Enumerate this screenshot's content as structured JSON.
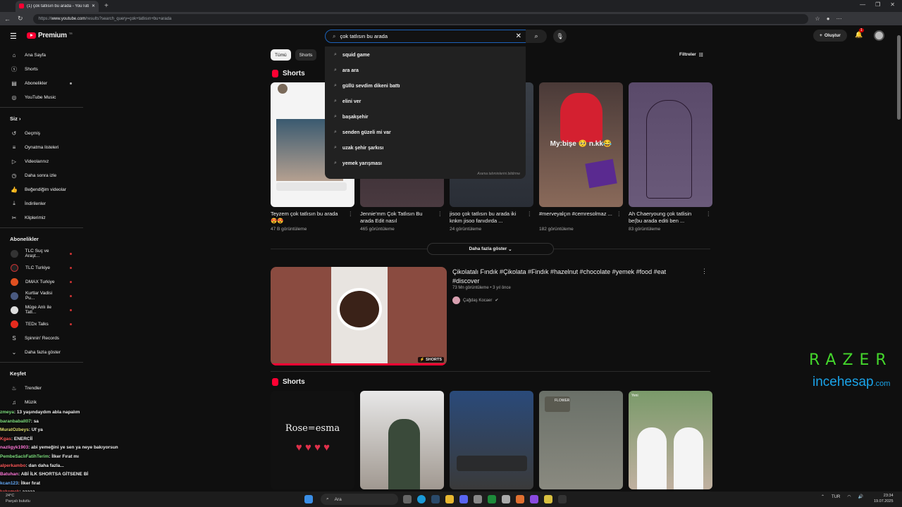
{
  "browser": {
    "tab_title": "(1) çok tatlısın bu arada - YouTube",
    "url_prefix": "https://",
    "url_host": "www.youtube.com",
    "url_path": "/results?search_query=çok+tatlısın+bu+arada"
  },
  "masthead": {
    "logo_text": "Premium",
    "logo_sup": "TR",
    "search_value": "çok tatlısın bu arada",
    "create_label": "Oluştur",
    "notif_count": "1"
  },
  "suggestions": {
    "items": [
      "squid game",
      "ara ara",
      "güllü sevdim dikeni battı",
      "elini ver",
      "başakşehir",
      "senden güzeli mi var",
      "uzak şehir şarkısı",
      "yemek yarışması"
    ],
    "footer": "Arama tahminlerini bildirme"
  },
  "sidebar": {
    "main": [
      "Ana Sayfa",
      "Shorts",
      "Abonelikler",
      "YouTube Music"
    ],
    "you_header": "Siz",
    "you": [
      "Geçmiş",
      "Oynatma listeleri",
      "Videolarınız",
      "Daha sonra izle",
      "Beğendiğim videolar",
      "İndirilenler",
      "Kliplerimiz"
    ],
    "subs_header": "Abonelikler",
    "subs": [
      "TLC Suç ve Araşt...",
      "TLC Turkiye",
      "DMAX Turkiye",
      "Kurtlar Vadisi Pu...",
      "Müge Anlı ile Tatl...",
      "TEDx Talks",
      "Spinnin' Records",
      "Daha fazla göster"
    ],
    "explore_header": "Keşfet",
    "explore": [
      "Trendler",
      "Müzik"
    ]
  },
  "chips": [
    "Tümü",
    "Shorts"
  ],
  "filters_label": "Filtreler",
  "shorts_title": "Shorts",
  "shorts1": [
    {
      "title": "Teyzem çok tatlısın bu arada 😍😍",
      "views": "47 B görüntüleme"
    },
    {
      "title": "Jennie'mm Çok Tatlısın Bu arada Edit nasıl",
      "views": "465 görüntüleme"
    },
    {
      "title": "jisoo çok tatlısın bu arada iki knkm jisoo fanıdırda ...",
      "views": "24 görüntüleme"
    },
    {
      "title": "#merveyalçın #cemresolmaz ...",
      "views": "182 görüntüleme"
    },
    {
      "title": "Ah Chaeryoung çok tatlisin be(bu arada editi ben ...",
      "views": "83 görüntüleme"
    }
  ],
  "more_label": "Daha fazla göster",
  "video": {
    "title": "Çikolatalı Fındık #Çikolata #Findık #hazelnut #chocolate #yemek #food #eat #discover",
    "meta": "73 Mn görüntüleme • 3 yıl önce",
    "channel": "Çağdaş Kocaer",
    "badge": "SHORTS"
  },
  "thumb_text": {
    "merve": "My:bişe 🥺 n.kk😂",
    "rose": "Rose=esma",
    "flower": "FLOWER",
    "yeni": "Yeni"
  },
  "overlay": {
    "razer": "RAZER",
    "ince": "incehesap",
    "ince_suffix": ".com"
  },
  "chat": [
    {
      "u": "zmeya",
      "m": ": 13 yaşındaydım abla napalım",
      "c": ""
    },
    {
      "u": "baranbaball07",
      "m": ": sa",
      "c": ""
    },
    {
      "u": "MuratOzbeys",
      "m": ": Uf ya",
      "c": "y"
    },
    {
      "u": "Kgas",
      "m": ": ENERCİİ",
      "c": "r"
    },
    {
      "u": "nazligyk1903",
      "m": ": abi yemeğini ye sen ya neye bakıyorsun",
      "c": "p"
    },
    {
      "u": "PembeSaclıFatihTerim",
      "m": ": İlker Fırat mı",
      "c": ""
    },
    {
      "u": "alperkambo",
      "m": ": dan daha fazla...",
      "c": "r"
    },
    {
      "u": "Batuhan",
      "m": ": ABİ İLK SHORTSA GİTSENE Bİ",
      "c": "p"
    },
    {
      "u": "kcan123",
      "m": ": İlker fırat",
      "c": "b"
    },
    {
      "u": "kekemek",
      "m": ": aaaaa",
      "c": "r"
    }
  ],
  "taskbar": {
    "weather_temp": "24°C",
    "weather_desc": "Parçalı bulutlu",
    "search": "Ara",
    "lang": "TUR",
    "time": "23:34",
    "date": "19.07.2025"
  }
}
